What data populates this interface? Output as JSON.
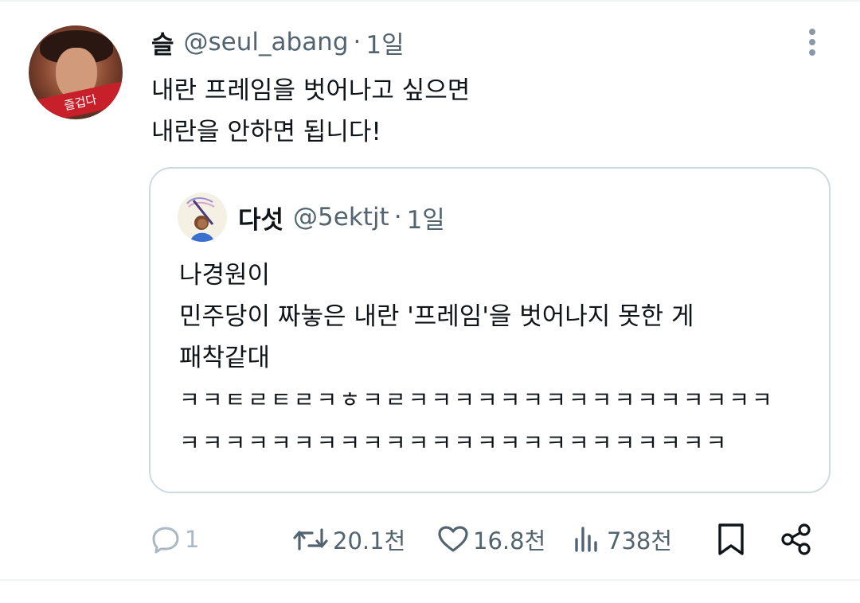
{
  "tweet": {
    "display_name": "슬",
    "handle": "@seul_abang",
    "separator": "·",
    "time": "1일",
    "avatar_label": "즐겁다",
    "text_lines": [
      "내란 프레임을 벗어나고 싶으면",
      "내란을 안하면 됩니다!"
    ]
  },
  "quote": {
    "display_name": "다섯",
    "handle": "@5ektjt",
    "separator": "·",
    "time": "1일",
    "text_lines": [
      "나경원이",
      "민주당이 짜놓은 내란 '프레임'을 벗어나지 못한 게",
      "패착같대",
      "ㅋㅋㅌㄹㅌㄹㅋㅎㅋㄹㅋㅋㅋㅋㅋㅋㅋㅋㅋㅋㅋㅋㅋㅋㅋㅋ",
      "ㅋㅋㅋㅋㅋㅋㅋㅋㅋㅋㅋㅋㅋㅋㅋㅋㅋㅋㅋㅋㅋㅋㅋㅋ"
    ]
  },
  "actions": {
    "reply_count": "1",
    "retweet_count": "20.1천",
    "like_count": "16.8천",
    "views_count": "738천"
  },
  "icons": {
    "reply": "reply-icon",
    "retweet": "retweet-icon",
    "like": "heart-icon",
    "views": "views-icon",
    "bookmark": "bookmark-icon",
    "share": "share-icon",
    "more": "more-vertical-icon"
  },
  "colors": {
    "text_primary": "#0f1419",
    "text_secondary": "#536471",
    "border": "#cfd9de",
    "reply_muted": "#aab8c2"
  }
}
